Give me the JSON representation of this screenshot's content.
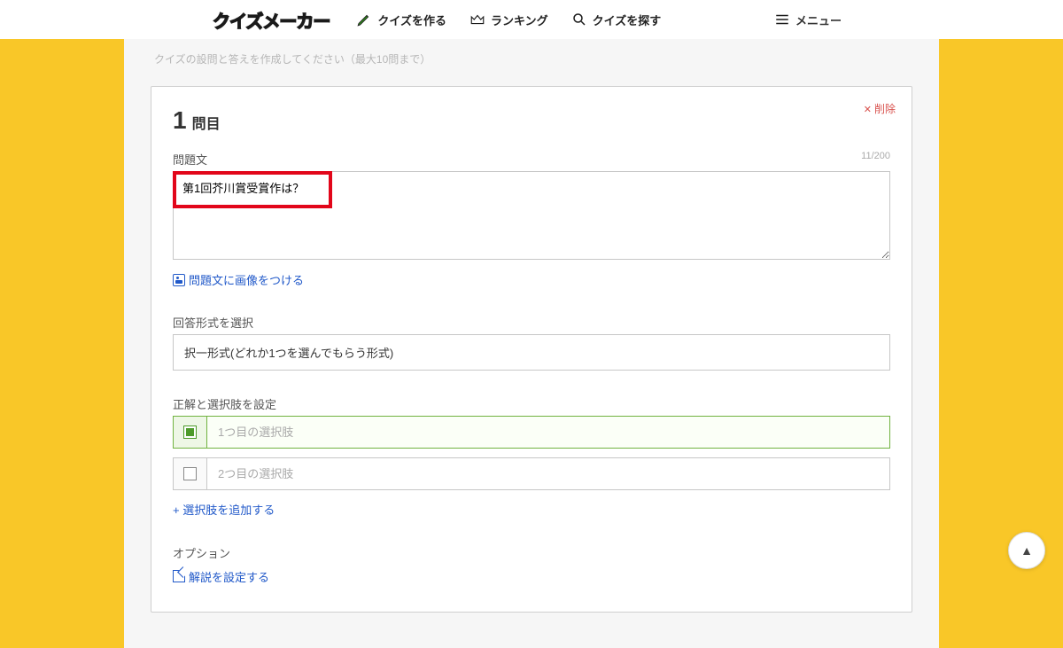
{
  "header": {
    "logo": "クイズメーカー",
    "nav": {
      "create": "クイズを作る",
      "ranking": "ランキング",
      "search": "クイズを探す"
    },
    "menu": "メニュー"
  },
  "hint": "クイズの設問と答えを作成してください（最大10問まで）",
  "question": {
    "number": "1",
    "suffix": "問目",
    "delete": "削除",
    "text_label": "問題文",
    "text_value": "第1回芥川賞受賞作は？",
    "counter": "11/200",
    "image_link": "問題文に画像をつける",
    "format_label": "回答形式を選択",
    "format_value": "択一形式(どれか1つを選んでもらう形式)",
    "choices_label": "正解と選択肢を設定",
    "choice1_placeholder": "1つ目の選択肢",
    "choice2_placeholder": "2つ目の選択肢",
    "add_choice": "+ 選択肢を追加する",
    "options_label": "オプション",
    "explain_link": "解説を設定する"
  }
}
